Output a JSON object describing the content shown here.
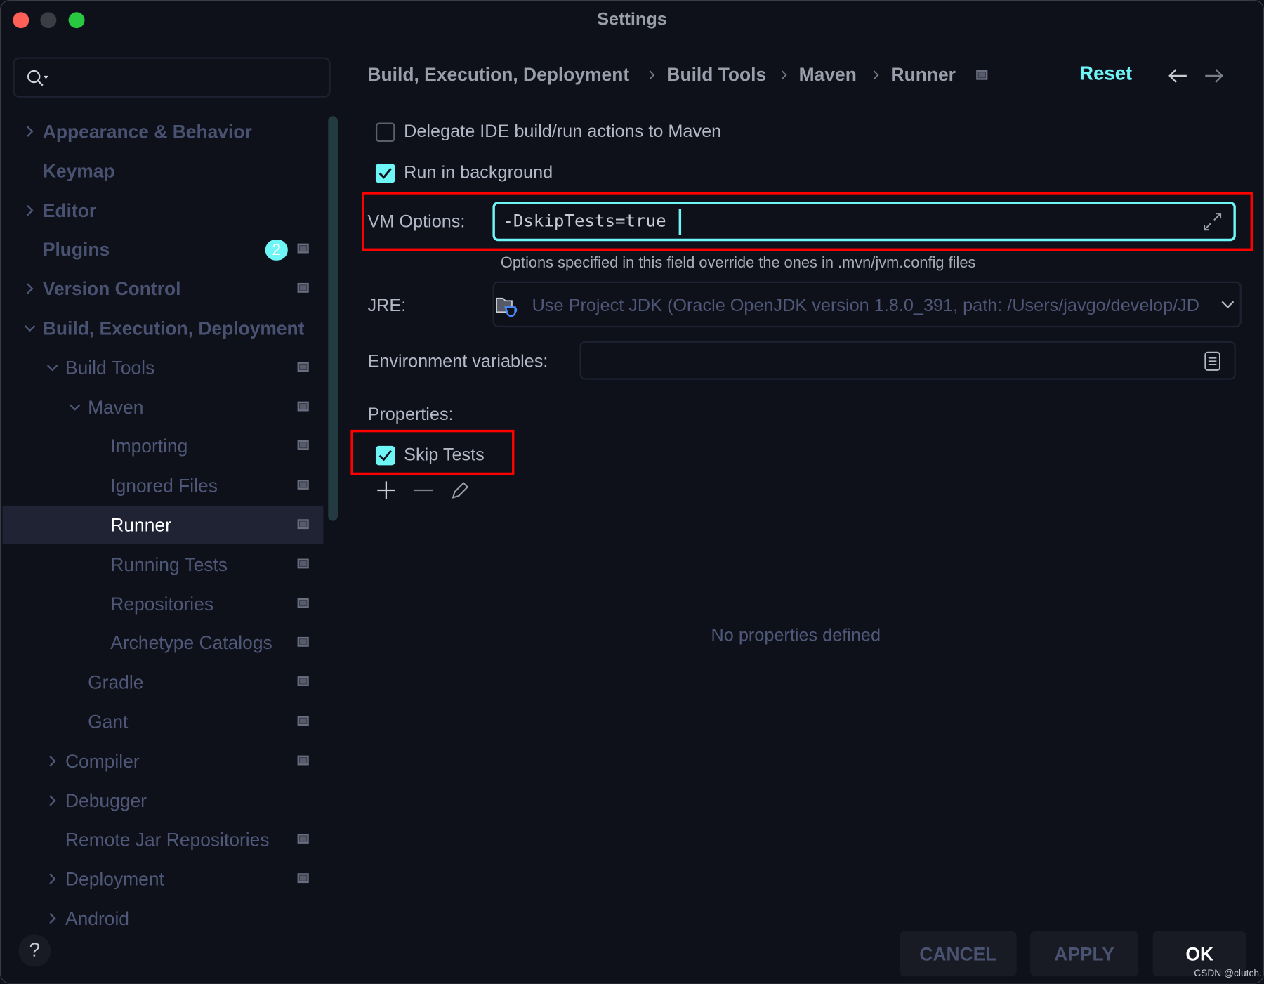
{
  "window": {
    "title": "Settings"
  },
  "search": {
    "placeholder": ""
  },
  "sidebar": {
    "items": [
      {
        "label": "Appearance & Behavior",
        "level": 0,
        "expander": "collapsed",
        "bold": true,
        "pin": false
      },
      {
        "label": "Keymap",
        "level": 0,
        "expander": "none",
        "bold": true,
        "pin": false
      },
      {
        "label": "Editor",
        "level": 0,
        "expander": "collapsed",
        "bold": true,
        "pin": false
      },
      {
        "label": "Plugins",
        "level": 0,
        "expander": "none",
        "bold": true,
        "pin": true,
        "badge": "2"
      },
      {
        "label": "Version Control",
        "level": 0,
        "expander": "collapsed",
        "bold": true,
        "pin": true
      },
      {
        "label": "Build, Execution, Deployment",
        "level": 0,
        "expander": "expanded",
        "bold": true,
        "pin": false
      },
      {
        "label": "Build Tools",
        "level": 1,
        "expander": "expanded",
        "pin": true
      },
      {
        "label": "Maven",
        "level": 2,
        "expander": "expanded",
        "pin": true
      },
      {
        "label": "Importing",
        "level": 3,
        "expander": "none",
        "pin": true
      },
      {
        "label": "Ignored Files",
        "level": 3,
        "expander": "none",
        "pin": true
      },
      {
        "label": "Runner",
        "level": 3,
        "expander": "none",
        "pin": true,
        "selected": true
      },
      {
        "label": "Running Tests",
        "level": 3,
        "expander": "none",
        "pin": true
      },
      {
        "label": "Repositories",
        "level": 3,
        "expander": "none",
        "pin": true
      },
      {
        "label": "Archetype Catalogs",
        "level": 3,
        "expander": "none",
        "pin": true
      },
      {
        "label": "Gradle",
        "level": 2,
        "expander": "none",
        "pin": true
      },
      {
        "label": "Gant",
        "level": 2,
        "expander": "none",
        "pin": true
      },
      {
        "label": "Compiler",
        "level": 1,
        "expander": "collapsed",
        "pin": true
      },
      {
        "label": "Debugger",
        "level": 1,
        "expander": "collapsed",
        "pin": false
      },
      {
        "label": "Remote Jar Repositories",
        "level": 1,
        "expander": "none",
        "pin": true
      },
      {
        "label": "Deployment",
        "level": 1,
        "expander": "collapsed",
        "pin": true
      },
      {
        "label": "Android",
        "level": 1,
        "expander": "collapsed",
        "pin": false
      }
    ]
  },
  "breadcrumb": [
    "Build, Execution, Deployment",
    "Build Tools",
    "Maven",
    "Runner"
  ],
  "header": {
    "reset_label": "Reset"
  },
  "options": {
    "delegate": {
      "label": "Delegate IDE build/run actions to Maven",
      "checked": false
    },
    "background": {
      "label": "Run in background",
      "checked": true
    }
  },
  "vm": {
    "label": "VM Options:",
    "value": "-DskipTests=true",
    "hint": "Options specified in this field override the ones in .mvn/jvm.config files"
  },
  "jre": {
    "label": "JRE:",
    "value": "Use Project JDK (Oracle OpenJDK version 1.8.0_391, path: /Users/javgo/develop/JD"
  },
  "env": {
    "label": "Environment variables:",
    "value": ""
  },
  "properties": {
    "label": "Properties:",
    "skip_tests": {
      "label": "Skip Tests",
      "checked": true
    },
    "empty_text": "No properties defined"
  },
  "footer": {
    "cancel": "CANCEL",
    "apply": "APPLY",
    "ok": "OK",
    "help": "?"
  },
  "watermark": "CSDN @clutch.",
  "colors": {
    "accent": "#6ef5f5",
    "background": "#0e111a",
    "highlight": "#ff0000",
    "selection": "#1f2333"
  }
}
